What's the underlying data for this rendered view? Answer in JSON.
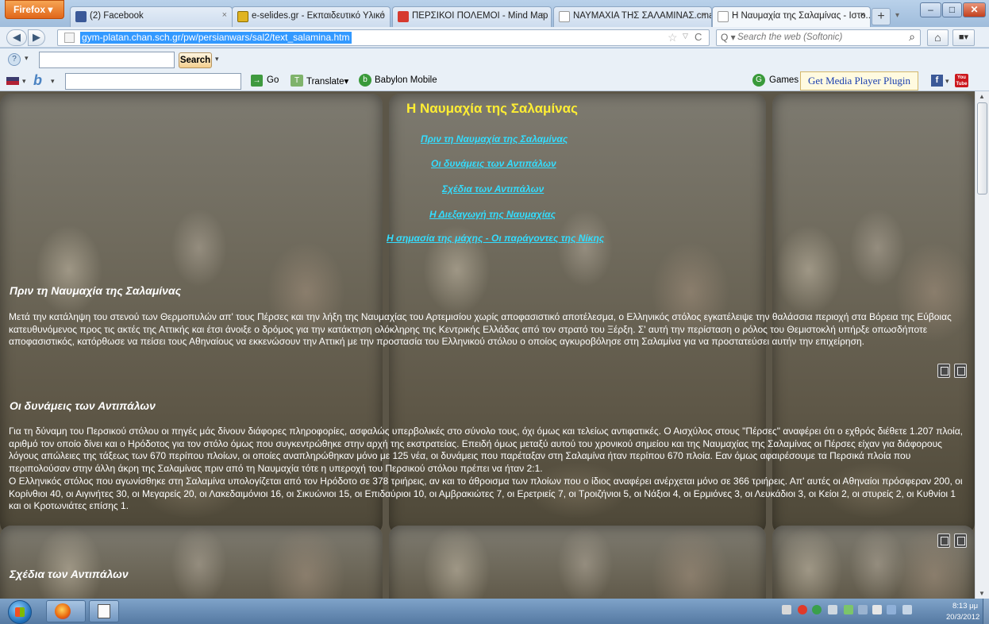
{
  "browser": {
    "menu_label": "Firefox",
    "menu_arrow": "▾",
    "tabs": [
      {
        "label": "(2) Facebook",
        "icon": "facebook-icon",
        "color": "#3b5998"
      },
      {
        "label": "e-selides.gr - Εκπαιδευτικό Υλικό",
        "icon": "book-icon",
        "color": "#e0b422"
      },
      {
        "label": "ΠΕΡΣΙΚΟΙ ΠΟΛΕΜΟΙ - Mind Map",
        "icon": "mindmap-icon",
        "color": "#d63a2f"
      },
      {
        "label": "ΝΑΥΜΑΧΙΑ ΤΗΣ ΣΑΛΑΜΙΝΑΣ.cma...",
        "icon": "page-icon",
        "color": "#ffffff"
      },
      {
        "label": "Η Ναυμαχία της Σαλαμίνας - Ιστο...",
        "icon": "page-icon",
        "color": "#ffffff"
      }
    ],
    "tab_close": "×",
    "new_tab": "+",
    "tab_list": "▾",
    "window_minimize": "–",
    "window_maximize": "□",
    "window_close": "✕",
    "back": "◀",
    "forward": "▶",
    "url": "gym-platan.chan.sch.gr/pw/persianwars/sal2/text_salamina.htm",
    "bookmark_star": "☆",
    "url_dropdown": "▽",
    "reload": "C",
    "search_placeholder": "Search the web (Softonic)",
    "search_engine": "Q ▾",
    "search_go": "⌕",
    "home": "⌂",
    "addon_button": "■▾"
  },
  "toolbar1": {
    "icon": "?",
    "dropdown": "▾",
    "search_button": "Search",
    "search_dropdown": "▾"
  },
  "toolbar2": {
    "flag_dropdown": "▾",
    "logo": "b",
    "logo_dropdown": "▾",
    "go_icon": "→",
    "go_label": "Go",
    "translate_icon": "T",
    "translate_label": "Translate▾",
    "mobile_icon": "b",
    "mobile_label": "Babylon Mobile",
    "games_icon": "G",
    "games_label": "Games",
    "plugin_button": "Get Media Player Plugin",
    "facebook_icon": "f",
    "facebook_dropdown": "▾",
    "youtube_icon": "You Tube"
  },
  "page": {
    "title": "Η Ναυμαχία της Σαλαμίνας",
    "toc": [
      "Πριν τη Ναυμαχία της Σαλαμίνας",
      "Οι δυνάμεις των Αντιπάλων",
      "Σχέδια των Αντιπάλων",
      "Η Διεξαγωγή της Ναυμαχίας",
      "Η σημασία της μάχης - Οι παράγοντες της Νίκης"
    ],
    "sections": [
      {
        "heading": "Πριν τη Ναυμαχία της Σαλαμίνας",
        "paragraphs": [
          "Μετά την κατάληψη του στενού των Θερμοπυλών απ' τους Πέρσες και την λήξη της Ναυμαχίας του Αρτεμισίου χωρίς αποφασιστικό αποτέλεσμα, ο Ελληνικός στόλος εγκατέλειψε την θαλάσσια περιοχή στα Βόρεια της Εύβοιας κατευθυνόμενος προς τις ακτές της Αττικής και έτσι άνοιξε ο δρόμος για την κατάκτηση ολόκληρης της Κεντρικής Ελλάδας από τον στρατό του Ξέρξη. Σ' αυτή την περίσταση ο ρόλος του Θεμιστοκλή υπήρξε οπωσδήποτε αποφασιστικός, κατόρθωσε να πείσει τους Αθηναίους να εκκενώσουν την Αττική με την προστασία του Ελληνικού στόλου ο οποίος αγκυροβόλησε στη Σαλαμίνα για να προστατεύσει αυτήν την επιχείρηση."
        ]
      },
      {
        "heading": "Οι δυνάμεις των Αντιπάλων",
        "paragraphs": [
          "Για τη δύναμη του Περσικού στόλου οι πηγές μάς δίνουν διάφορες πληροφορίες, ασφαλώς υπερβολικές στο σύνολο τους, όχι όμως και τελείως αντιφατικές. Ο Αισχύλος στους \"Πέρσες\" αναφέρει ότι ο εχθρός διέθετε 1.207 πλοία, αριθμό τον οποίο δίνει και ο Ηρόδοτος για τον στόλο όμως που συγκεντρώθηκε στην αρχή της εκστρατείας. Επειδή όμως μεταξύ αυτού του χρονικού σημείου και της Ναυμαχίας της Σαλαμίνας οι Πέρσες είχαν για διάφορους λόγους απώλειες της τάξεως των  670 περίπου πλοίων, οι οποίες αναπληρώθηκαν μόνο με 125 νέα, οι δυνάμεις που παρέταξαν στη Σαλαμίνα ήταν περίπου 670 πλοία. Εαν όμως αφαιρέσουμε τα Περσικά πλοία που περιπολούσαν στην άλλη άκρη της Σαλαμίνας πριν από τη Ναυμαχία τότε η υπεροχή του Περσικού στόλου πρέπει να ήταν 2:1.",
          "Ο Ελληνικός στόλος που αγωνίσθηκε στη Σαλαμίνα υπολογίζεται από τον Ηρόδοτο σε 378 τριήρεις, αν και το άθροισμα των πλοίων που ο ίδιος αναφέρει ανέρχεται μόνο σε 366 τριήρεις. Απ' αυτές οι Αθηναίοι πρόσφεραν 200, οι Κορίνθιοι 40, οι Αιγινήτες 30, οι Μεγαρείς 20, οι Λακεδαιμόνιοι 16, οι Σικυώνιοι 15, οι Επιδαύριοι 10, οι Αμβρακιώτες 7, οι Ερετριείς 7, οι Τροιζήνιοι 5, οι Νάξιοι 4, οι Ερμιόνες 3, οι Λευκάδιοι 3, οι Κείοι 2, οι στυρείς 2, οι Κυθνίοι 1 και οι Κροτωνιάτες επίσης 1."
        ]
      },
      {
        "heading": "Σχέδια των Αντιπάλων",
        "paragraphs": []
      }
    ]
  },
  "taskbar": {
    "clock_time": "8:13 μμ",
    "clock_date": "20/3/2012"
  }
}
